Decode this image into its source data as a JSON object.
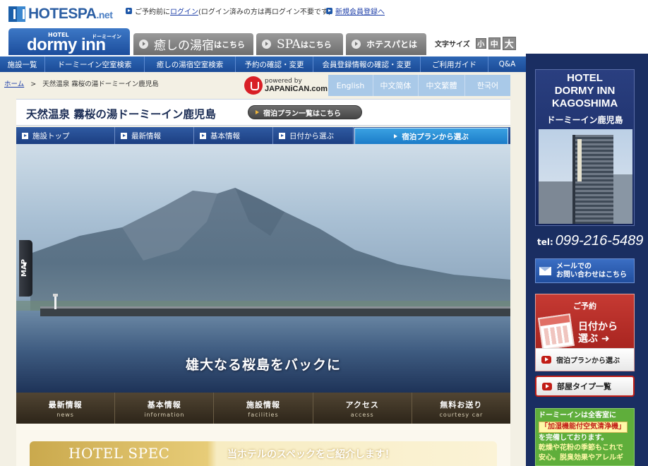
{
  "header": {
    "logo_text": "HOTESPA",
    "logo_suffix": ".net",
    "prelogin_text_a": "ご予約前に",
    "prelogin_link": "ログイン",
    "prelogin_text_b": "(ログイン済みの方は再ログイン不要です)",
    "register_link": "新規会員登録へ",
    "fontsize_label": "文字サイズ",
    "fontsize_options": [
      "小",
      "中",
      "大"
    ]
  },
  "brand_tabs": {
    "dormy_hotel": "HOTEL",
    "dormy_word": "dormy inn",
    "dormy_kana": "ドーミーイン",
    "tab1_big": "癒しの湯宿",
    "tab1_small": "はこちら",
    "tab2_big": "SPA",
    "tab2_small": "はこちら",
    "tab3_big": "ホテスパとは",
    "tab3_small": ""
  },
  "nav": {
    "items": [
      "施設一覧",
      "ドーミーイン空室検索",
      "癒しの湯宿空室検索",
      "予約の確認・変更",
      "会員登録情報の確認・変更",
      "ご利用ガイド",
      "Q&A"
    ]
  },
  "breadcrumb": {
    "home": "ホーム",
    "sep": ">",
    "current": "天然温泉 霧桜の湯ドーミーイン鹿児島"
  },
  "japanican": {
    "powered": "powered by",
    "brand": "JAPANiCAN.com"
  },
  "languages": [
    "English",
    "中文简体",
    "中文繁體",
    "한국어"
  ],
  "title": {
    "hotel_name": "天然温泉 霧桜の湯ドーミーイン鹿児島",
    "plan_list_button": "宿泊プラン一覧はこちら"
  },
  "subnav": {
    "items": [
      "施設トップ",
      "最新情報",
      "基本情報",
      "日付から選ぶ"
    ],
    "active": "宿泊プランから選ぶ"
  },
  "hero": {
    "caption": "雄大なる桜島をバックに",
    "map_tab": "MAP"
  },
  "bottom_menu": [
    {
      "jp": "最新情報",
      "en": "news"
    },
    {
      "jp": "基本情報",
      "en": "information"
    },
    {
      "jp": "施設情報",
      "en": "facilities"
    },
    {
      "jp": "アクセス",
      "en": "access"
    },
    {
      "jp": "無料お送り",
      "en": "courtesy car"
    }
  ],
  "spec": {
    "title_en": "HOTEL SPEC",
    "title_jp": "当ホテルのスペックをご紹介します！"
  },
  "sidebar": {
    "hotel_line1": "HOTEL",
    "hotel_line2": "DORMY INN",
    "hotel_line3": "KAGOSHIMA",
    "hotel_jp": "ドーミーイン鹿児島",
    "tel_label": "tel:",
    "tel_number": "099-216-5489",
    "mail_line1": "メールでの",
    "mail_line2": "お問い合わせはこちら",
    "reserve_title": "ご予約",
    "reserve_date_line1": "日付から",
    "reserve_date_line2": "選ぶ",
    "plan_button": "宿泊プランから選ぶ",
    "roomtype_button": "部屋タイプ一覧",
    "eco_line1": "ドーミーインは全客室に",
    "eco_highlight": "「加湿機能付空気清浄機」",
    "eco_line2": "を完備しております。",
    "eco_line3": "乾燥や花粉の季節もこれで",
    "eco_line4": "安心。脱臭効果やアレルギ"
  }
}
